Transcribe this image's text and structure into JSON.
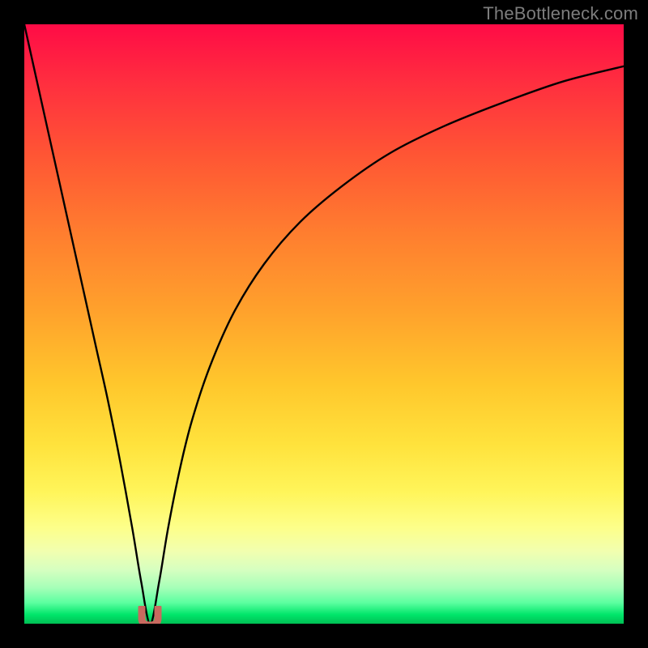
{
  "watermark": "TheBottleneck.com",
  "colors": {
    "frame": "#000000",
    "curve": "#000000",
    "marker": "#c86a5f",
    "watermark_text": "#7d7d7d"
  },
  "chart_data": {
    "type": "line",
    "title": "",
    "xlabel": "",
    "ylabel": "",
    "xlim": [
      0,
      100
    ],
    "ylim": [
      0,
      100
    ],
    "grid": false,
    "legend": false,
    "annotations": [
      "TheBottleneck.com"
    ],
    "optimum_x": 21,
    "background_gradient": "vertical, red (top) through orange/yellow to green (bottom); value decreases downward",
    "x": [
      0,
      2,
      4,
      6,
      8,
      10,
      12,
      14,
      16,
      18,
      19.5,
      21,
      22.5,
      24,
      26,
      28,
      31,
      35,
      40,
      46,
      53,
      61,
      70,
      80,
      90,
      100
    ],
    "values": [
      100,
      91,
      82,
      73,
      64,
      55,
      46,
      37,
      27,
      16,
      7,
      0,
      7,
      16,
      26,
      34,
      43,
      52,
      60,
      67,
      73,
      78.5,
      83,
      87,
      90.5,
      93
    ],
    "marker": {
      "x": 21,
      "y": 0,
      "shape": "U",
      "color": "#c86a5f"
    }
  }
}
